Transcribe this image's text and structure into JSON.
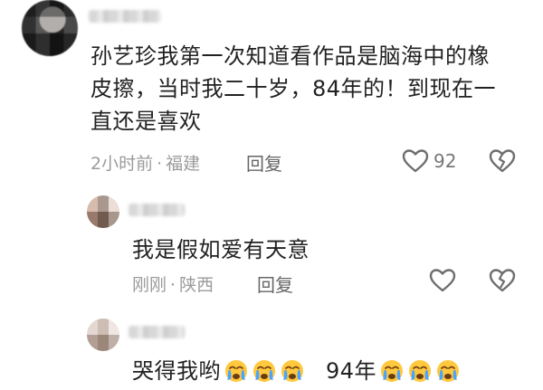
{
  "comments": [
    {
      "text_line1": "孙艺珍我第一次知道看作品是脑海中的橡",
      "text_line2": "皮擦，当时我二十岁，84年的！到现在一",
      "text_line3": "直还是喜欢",
      "time": "2小时前",
      "separator": "·",
      "location": "福建",
      "reply_label": "回复",
      "like_count": "92"
    }
  ],
  "replies": [
    {
      "text": "我是假如爱有天意",
      "time": "刚刚",
      "separator": "·",
      "location": "陕西",
      "reply_label": "回复"
    },
    {
      "text_part1": "哭得我哟",
      "text_part2": "94年",
      "emoji": "😭"
    }
  ],
  "icons": {
    "like": "heart-outline-icon",
    "dislike": "broken-heart-icon",
    "emoji": "crying-face-emoji"
  },
  "colors": {
    "text": "#222222",
    "meta": "#9b9b9b",
    "icon": "#6e6e6e",
    "emoji_face": "#ffc83d",
    "emoji_tear": "#4aa3ff"
  }
}
